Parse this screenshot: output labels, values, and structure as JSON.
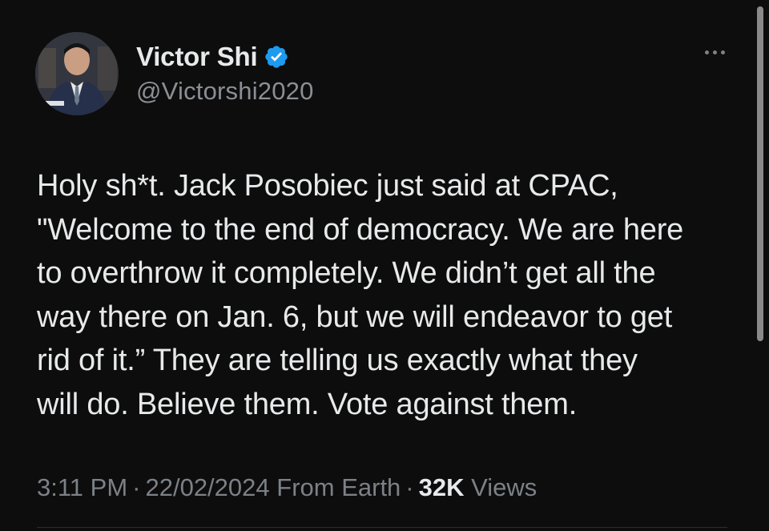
{
  "user": {
    "display_name": "Victor Shi",
    "handle": "@Victorshi2020",
    "verified_icon": "verified-badge-icon",
    "verified_color": "#1d9bf0"
  },
  "tweet": {
    "lines": [
      "Holy sh*t. Jack Posobiec just said at CPAC,",
      "\"Welcome to the end of democracy. We are here",
      "to overthrow it completely. We didn’t get all the",
      "way there on Jan. 6, but we will endeavor to get",
      "rid of it.” They are telling us exactly what they",
      "will do. Believe them. Vote against them."
    ]
  },
  "meta": {
    "time": "3:11 PM",
    "separator": "·",
    "date": "22/02/2024",
    "source": "From Earth",
    "views_count": "32K",
    "views_label": "Views"
  },
  "more_menu_icon": "more-horizontal-icon"
}
